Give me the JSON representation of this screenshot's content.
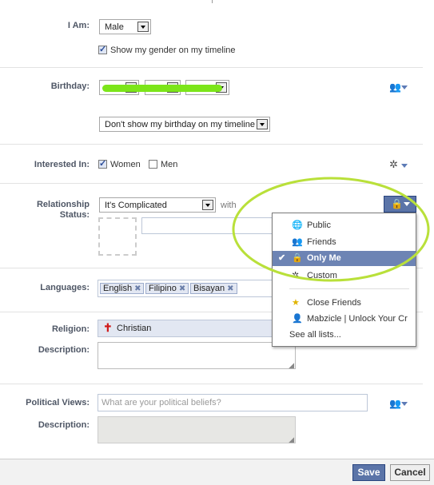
{
  "gender": {
    "label": "I Am:",
    "value": "Male",
    "show_on_timeline_checked": true,
    "show_on_timeline_label": "Show my gender on my timeline"
  },
  "birthday": {
    "label": "Birthday:",
    "visibility_value": "Don't show my birthday on my timeline"
  },
  "interested_in": {
    "label": "Interested In:",
    "options": [
      {
        "label": "Women",
        "checked": true
      },
      {
        "label": "Men",
        "checked": false
      }
    ]
  },
  "relationship": {
    "label_line1": "Relationship",
    "label_line2": "Status:",
    "value": "It's Complicated",
    "with_label": "with"
  },
  "privacy_menu": {
    "items": [
      {
        "label": "Public",
        "icon": "globe-icon"
      },
      {
        "label": "Friends",
        "icon": "friends-icon"
      },
      {
        "label": "Only Me",
        "icon": "lock-icon",
        "selected": true
      },
      {
        "label": "Custom",
        "icon": "gear-icon"
      }
    ],
    "lists": [
      {
        "label": "Close Friends",
        "icon": "star-icon"
      },
      {
        "label": "Mabzicle | Unlock Your Cr",
        "icon": "user-icon"
      }
    ],
    "see_all": "See all lists..."
  },
  "languages": {
    "label": "Languages:",
    "tags": [
      "English",
      "Filipino",
      "Bisayan"
    ]
  },
  "religion": {
    "label": "Religion:",
    "value": "Christian",
    "description_label": "Description:"
  },
  "political": {
    "label": "Political Views:",
    "placeholder": "What are your political beliefs?",
    "description_label": "Description:"
  },
  "buttons": {
    "save": "Save",
    "cancel": "Cancel"
  },
  "colors": {
    "highlight_ellipse": "#b9e03a",
    "birthday_scribble": "#7ce51a",
    "menu_selected": "#6d84b4",
    "save_button": "#5b74a8"
  }
}
